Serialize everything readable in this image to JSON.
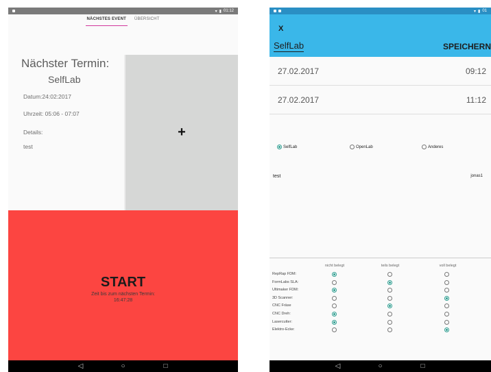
{
  "left_screen": {
    "statusbar": {
      "time": "01:12"
    },
    "tabs": [
      {
        "label": "NÄCHSTES EVENT",
        "active": true
      },
      {
        "label": "ÜBERSICHT",
        "active": false
      }
    ],
    "next_event": {
      "heading": "Nächster Termin:",
      "lab": "SelfLab",
      "date": "Datum:24:02:2017",
      "time": "Uhrzeit: 05:06 - 07:07",
      "details_label": "Details:",
      "details": "test"
    },
    "add_button": {
      "symbol": "+"
    },
    "start": {
      "label": "START",
      "countdown_label": "Zeit bis zum nächsten Termin:",
      "countdown_value": "16:47:28",
      "color": "#fc4541"
    }
  },
  "right_screen": {
    "statusbar": {
      "time": "01"
    },
    "header": {
      "close": "X",
      "title": "SelfLab",
      "save": "SPEICHERN",
      "color": "#3ab7e9"
    },
    "start": {
      "date": "27.02.2017",
      "time": "09:12"
    },
    "end": {
      "date": "27.02.2017",
      "time": "11:12"
    },
    "lab_options": [
      {
        "label": "SelfLab",
        "selected": true
      },
      {
        "label": "OpenLab",
        "selected": false
      },
      {
        "label": "Anderes",
        "selected": false
      }
    ],
    "description": "test",
    "user": "jonas1",
    "occupancy_columns": [
      "nicht belegt",
      "teils belegt",
      "voll belegt"
    ],
    "machines": [
      {
        "name": "RepRap FDM:",
        "selected": 0
      },
      {
        "name": "FormLabs SLA:",
        "selected": 1
      },
      {
        "name": "Ultimaker FDM:",
        "selected": 0
      },
      {
        "name": "3D Scanner:",
        "selected": 2
      },
      {
        "name": "CNC Fräse",
        "selected": 1
      },
      {
        "name": "CNC Dreh:",
        "selected": 0
      },
      {
        "name": "Lasercutter:",
        "selected": 0
      },
      {
        "name": "Elektro-Ecke:",
        "selected": 2
      }
    ],
    "accent_color": "#2a9d8f"
  },
  "navbar": {
    "back": "◁",
    "home": "○",
    "recents": "□"
  }
}
